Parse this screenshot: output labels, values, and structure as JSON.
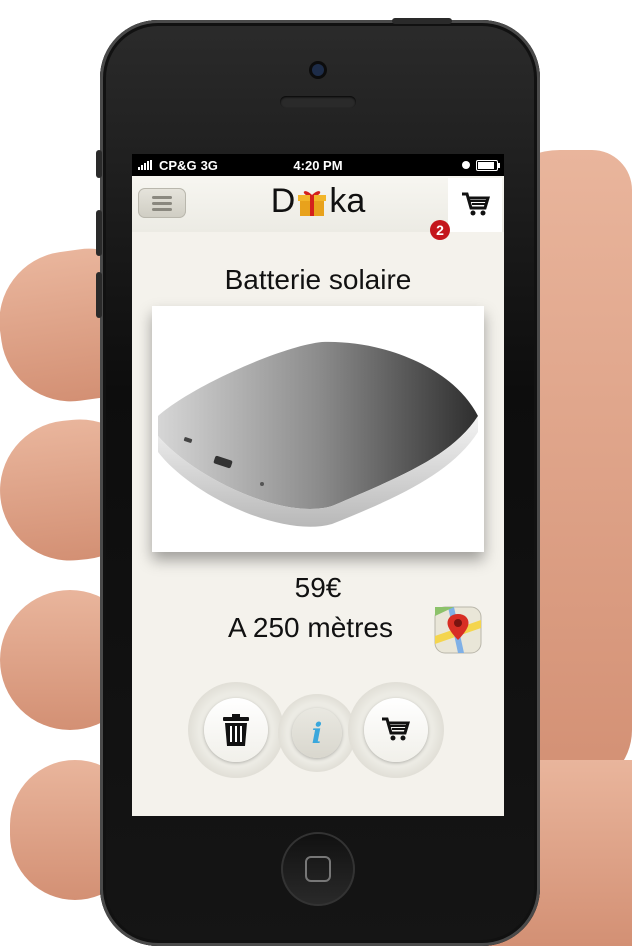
{
  "status_bar": {
    "carrier": "CP&G",
    "network": "3G",
    "time": "4:20 PM"
  },
  "header": {
    "app_name_prefix": "D",
    "app_name_suffix": "ka",
    "cart_count": "2"
  },
  "product": {
    "name": "Batterie solaire",
    "price": "59€",
    "distance": "A 250 mètres"
  },
  "icons": {
    "menu": "hamburger-icon",
    "logo": "gift-icon",
    "cart": "cart-icon",
    "map": "map-pin-icon",
    "delete": "trash-icon",
    "info": "info-icon",
    "add_to_cart": "cart-icon"
  },
  "colors": {
    "badge": "#c4161c",
    "info_accent": "#3aa7dc",
    "screen_background": "#f4f2ec"
  }
}
